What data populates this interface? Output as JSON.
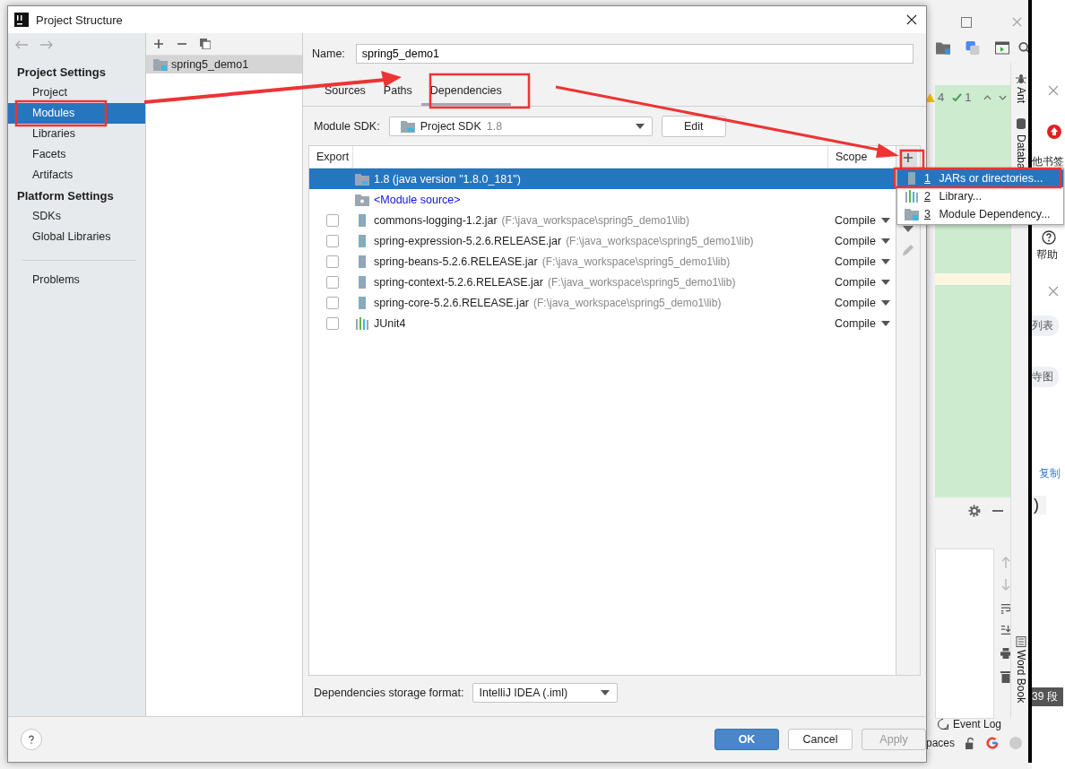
{
  "dialog": {
    "title": "Project Structure"
  },
  "sidebar": {
    "sections": [
      {
        "heading": "Project Settings",
        "items": [
          {
            "label": "Project",
            "selected": false
          },
          {
            "label": "Modules",
            "selected": true
          },
          {
            "label": "Libraries",
            "selected": false
          },
          {
            "label": "Facets",
            "selected": false
          },
          {
            "label": "Artifacts",
            "selected": false
          }
        ]
      },
      {
        "heading": "Platform Settings",
        "items": [
          {
            "label": "SDKs",
            "selected": false
          },
          {
            "label": "Global Libraries",
            "selected": false
          }
        ]
      }
    ],
    "footer_items": [
      {
        "label": "Problems",
        "selected": false
      }
    ]
  },
  "modules": {
    "items": [
      {
        "label": "spring5_demo1",
        "selected": true
      }
    ]
  },
  "module": {
    "name_label": "Name:",
    "name": "spring5_demo1",
    "tabs": [
      {
        "label": "Sources",
        "selected": false
      },
      {
        "label": "Paths",
        "selected": false
      },
      {
        "label": "Dependencies",
        "selected": true
      }
    ],
    "sdk_label": "Module SDK:",
    "sdk": "Project SDK",
    "sdk_version": "1.8",
    "edit_button": "Edit"
  },
  "table": {
    "columns": [
      "Export",
      "Scope"
    ],
    "rows": [
      {
        "kind": "sdk",
        "name": "1.8 (java version \"1.8.0_181\")",
        "selected": true
      },
      {
        "kind": "source",
        "name": "<Module source>",
        "selected": false
      },
      {
        "kind": "jar",
        "name": "commons-logging-1.2.jar",
        "path": "(F:\\java_workspace\\spring5_demo1\\lib)",
        "scope": "Compile",
        "checked": false,
        "selected": false
      },
      {
        "kind": "jar",
        "name": "spring-expression-5.2.6.RELEASE.jar",
        "path": "(F:\\java_workspace\\spring5_demo1\\lib)",
        "scope": "Compile",
        "checked": false,
        "selected": false
      },
      {
        "kind": "jar",
        "name": "spring-beans-5.2.6.RELEASE.jar",
        "path": "(F:\\java_workspace\\spring5_demo1\\lib)",
        "scope": "Compile",
        "checked": false,
        "selected": false
      },
      {
        "kind": "jar",
        "name": "spring-context-5.2.6.RELEASE.jar",
        "path": "(F:\\java_workspace\\spring5_demo1\\lib)",
        "scope": "Compile",
        "checked": false,
        "selected": false
      },
      {
        "kind": "jar",
        "name": "spring-core-5.2.6.RELEASE.jar",
        "path": "(F:\\java_workspace\\spring5_demo1\\lib)",
        "scope": "Compile",
        "checked": false,
        "selected": false
      },
      {
        "kind": "library",
        "name": "JUnit4",
        "scope": "Compile",
        "checked": false,
        "selected": false
      }
    ]
  },
  "add_menu": {
    "items": [
      {
        "key": "1",
        "label": "JARs or directories...",
        "kind": "jar",
        "selected": true
      },
      {
        "key": "2",
        "label": "Library...",
        "kind": "library",
        "selected": false
      },
      {
        "key": "3",
        "label": "Module Dependency...",
        "kind": "module",
        "selected": false
      }
    ]
  },
  "storage": {
    "label": "Dependencies storage format:",
    "value": "IntelliJ IDEA (.iml)"
  },
  "buttons": [
    {
      "label": "OK",
      "kind": "primary",
      "disabled": false
    },
    {
      "label": "Cancel",
      "kind": "normal",
      "disabled": false
    },
    {
      "label": "Apply",
      "kind": "normal",
      "disabled": true
    }
  ],
  "ide": {
    "warnings": "4",
    "checks": "1",
    "tool_windows": [
      "Ant",
      "Databa"
    ],
    "word_book": "Word Book",
    "event_log": "Event Log",
    "status": "paces"
  },
  "browser": {
    "bookmarks": "他书签",
    "help": "帮助",
    "list": "列表",
    "chart": "寺图",
    "copy": "复制",
    "paren": ")",
    "paragraph": "39 段"
  }
}
